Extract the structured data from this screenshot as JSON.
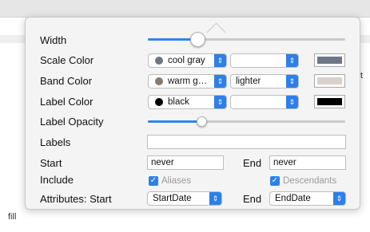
{
  "background": {
    "side_text_top": "t",
    "side_text_bottom": "fill"
  },
  "popover": {
    "width": {
      "label": "Width",
      "level": 0.25
    },
    "scale_color": {
      "label": "Scale Color",
      "popup": "cool gray",
      "swatch_color": "#6e7784",
      "second_popup": "",
      "well_color": "#6e7784"
    },
    "band_color": {
      "label": "Band Color",
      "popup": "warm g…",
      "swatch_color": "#867b6e",
      "second_popup": "lighter",
      "well_color": "#d6d2cb"
    },
    "label_color": {
      "label": "Label Color",
      "popup": "black",
      "swatch_color": "#000000",
      "second_popup": "",
      "well_color": "#000000"
    },
    "label_opacity": {
      "label": "Label Opacity",
      "level": 0.27
    },
    "labels": {
      "label": "Labels",
      "value": ""
    },
    "start": {
      "label": "Start",
      "value": "never"
    },
    "end": {
      "label": "End",
      "value": "never"
    },
    "include": {
      "label": "Include",
      "aliases": {
        "label": "Aliases",
        "checked": true
      },
      "descendants": {
        "label": "Descendants",
        "checked": true
      }
    },
    "attributes": {
      "label": "Attributes: Start",
      "start_popup": "StartDate",
      "end_label": "End",
      "end_popup": "EndDate"
    },
    "colors": {
      "accent": "#2d7fea",
      "popover_bg": "#f4f4f4"
    }
  }
}
